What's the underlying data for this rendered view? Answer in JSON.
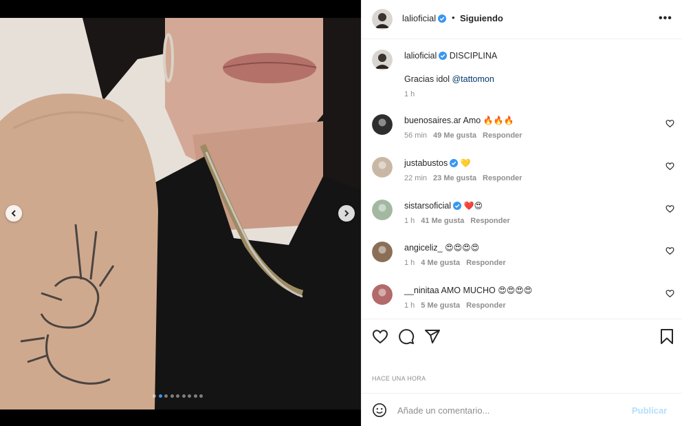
{
  "post": {
    "username": "lalioficial",
    "follow_separator": "•",
    "follow_status": "Siguiendo",
    "more_label": "•••",
    "caption_title": "DISCIPLINA",
    "caption_text": "Gracias idol",
    "caption_mention": "@tattomon",
    "caption_time": "1 h"
  },
  "comments": [
    {
      "user": "buenosaires.ar",
      "verified": false,
      "text": "Amo",
      "emoji": "🔥🔥🔥",
      "time": "56 min",
      "likes": "49 Me gusta",
      "reply": "Responder"
    },
    {
      "user": "justabustos",
      "verified": true,
      "text": "",
      "emoji": "💛",
      "time": "22 min",
      "likes": "23 Me gusta",
      "reply": "Responder"
    },
    {
      "user": "sistarsoficial",
      "verified": true,
      "text": "",
      "emoji": "❤️😍",
      "time": "1 h",
      "likes": "41 Me gusta",
      "reply": "Responder"
    },
    {
      "user": "angiceliz_",
      "verified": false,
      "text": "",
      "emoji": "😍😍😍😍",
      "time": "1 h",
      "likes": "4 Me gusta",
      "reply": "Responder"
    },
    {
      "user": "__ninitaa",
      "verified": false,
      "text": "AMO MUCHO",
      "emoji": "😍😍😍😍",
      "time": "1 h",
      "likes": "5 Me gusta",
      "reply": "Responder"
    }
  ],
  "timestamp": "HACE UNA HORA",
  "add_comment": {
    "placeholder": "Añade un comentario...",
    "publish_label": "Publicar"
  },
  "carousel": {
    "total": 9,
    "active_index": 1
  },
  "icons": {
    "like": "heart-icon",
    "comment": "comment-icon",
    "share": "share-icon",
    "save": "bookmark-icon",
    "emoji": "emoji-icon",
    "prev": "chevron-left-icon",
    "next": "chevron-right-icon"
  },
  "colors": {
    "verified": "#3897f0",
    "link": "#00376b",
    "muted": "#8e8e8e",
    "publish_disabled": "#b2dffc"
  }
}
